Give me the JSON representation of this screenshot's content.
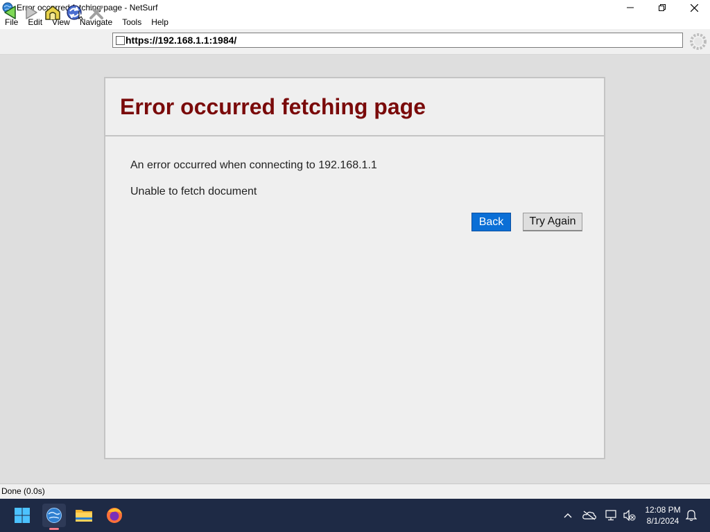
{
  "window": {
    "title": "Error occurred fetching page  -  NetSurf",
    "controls": [
      "minimize-icon",
      "restore-icon",
      "close-icon"
    ]
  },
  "menubar": {
    "items": [
      {
        "label": "File"
      },
      {
        "label": "Edit"
      },
      {
        "label": "View"
      },
      {
        "label": "Navigate"
      },
      {
        "label": "Tools"
      },
      {
        "label": "Help"
      }
    ]
  },
  "toolbar": {
    "buttons": [
      "back-arrow-icon",
      "forward-arrow-icon",
      "home-icon",
      "reload-icon",
      "stop-icon"
    ],
    "url": "https://192.168.1.1:1984/"
  },
  "error_page": {
    "title": "Error occurred fetching page",
    "message": "An error occurred when connecting to 192.168.1.1",
    "detail": "Unable to fetch document",
    "back_label": "Back",
    "retry_label": "Try Again",
    "title_color": "#7a0a0a",
    "back_color": "#0b6fd6"
  },
  "statusbar": {
    "text": "Done (0.0s)"
  },
  "taskbar": {
    "apps": [
      "windows-start-icon",
      "netsurf-icon",
      "file-explorer-icon",
      "firefox-icon"
    ],
    "tray": [
      "chevron-up-icon",
      "onedrive-icon",
      "network-icon",
      "volume-muted-icon",
      "notification-bell-icon"
    ],
    "time": "12:08 PM",
    "date": "8/1/2024"
  }
}
